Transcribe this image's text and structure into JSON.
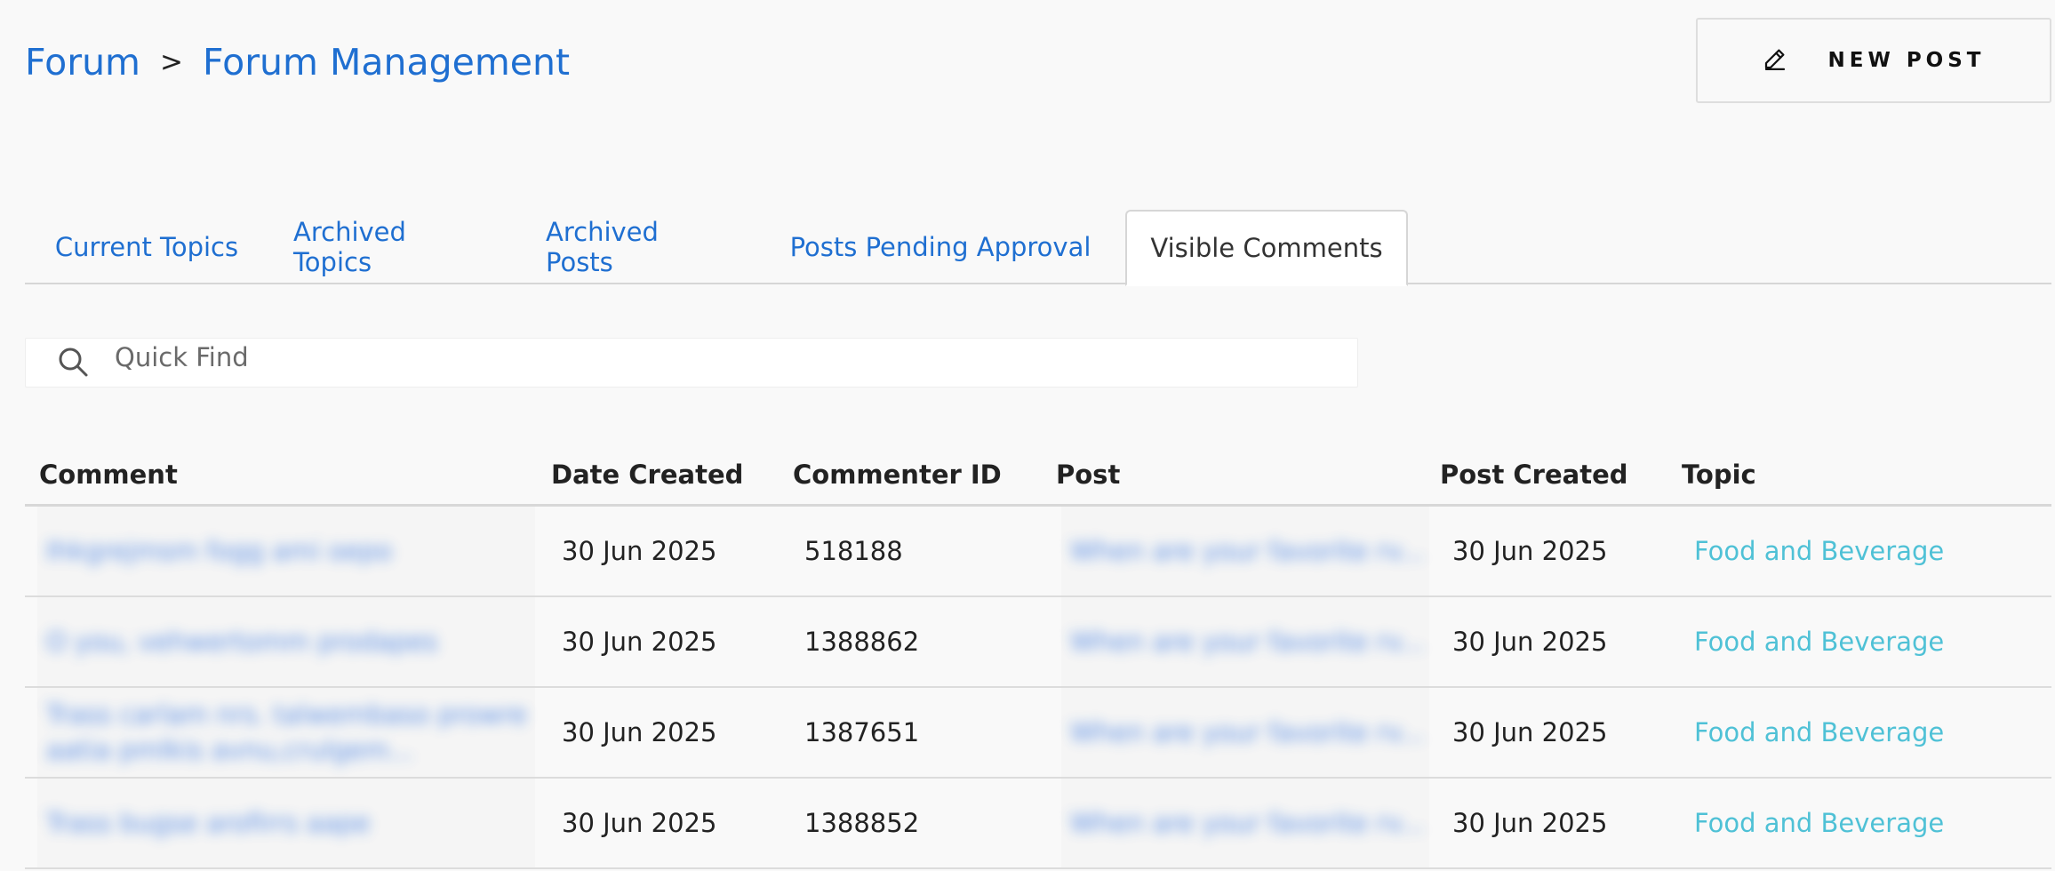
{
  "breadcrumb": {
    "root": "Forum",
    "separator": ">",
    "current": "Forum Management"
  },
  "new_post": {
    "label": "NEW POST",
    "icon": "pencil-icon"
  },
  "tabs": [
    {
      "label": "Current Topics",
      "active": false
    },
    {
      "label": "Archived Topics",
      "active": false
    },
    {
      "label": "Archived Posts",
      "active": false
    },
    {
      "label": "Posts Pending Approval",
      "active": false
    },
    {
      "label": "Visible Comments",
      "active": true
    }
  ],
  "search": {
    "placeholder": "Quick Find",
    "icon": "search-icon",
    "value": ""
  },
  "table": {
    "headers": {
      "comment": "Comment",
      "date_created": "Date Created",
      "commenter_id": "Commenter ID",
      "post": "Post",
      "post_created": "Post Created",
      "topic": "Topic"
    },
    "rows": [
      {
        "comment": "Ihkgrejmsm fogg ami oepo",
        "date_created": "30 Jun 2025",
        "commenter_id": "518188",
        "post": "When are your favorite rv...",
        "post_created": "30 Jun 2025",
        "topic": "Food and Beverage"
      },
      {
        "comment": "O you, vehwertomm prodapes",
        "date_created": "30 Jun 2025",
        "commenter_id": "1388862",
        "post": "When are your favorite rv...",
        "post_created": "30 Jun 2025",
        "topic": "Food and Beverage"
      },
      {
        "comment": "Trass carlam nrs. talwembaso prowre aatia pmlkis avnu,crulgem...",
        "date_created": "30 Jun 2025",
        "commenter_id": "1387651",
        "post": "When are your favorite rv...",
        "post_created": "30 Jun 2025",
        "topic": "Food and Beverage"
      },
      {
        "comment": "Trass bugse arofirrs aape",
        "date_created": "30 Jun 2025",
        "commenter_id": "1388852",
        "post": "When are your favorite rv...",
        "post_created": "30 Jun 2025",
        "topic": "Food and Beverage"
      }
    ]
  },
  "colors": {
    "link": "#1f6fd1",
    "topic_link": "#4fc1d6",
    "background": "#f9f9f9",
    "border": "#d6d6d6"
  }
}
